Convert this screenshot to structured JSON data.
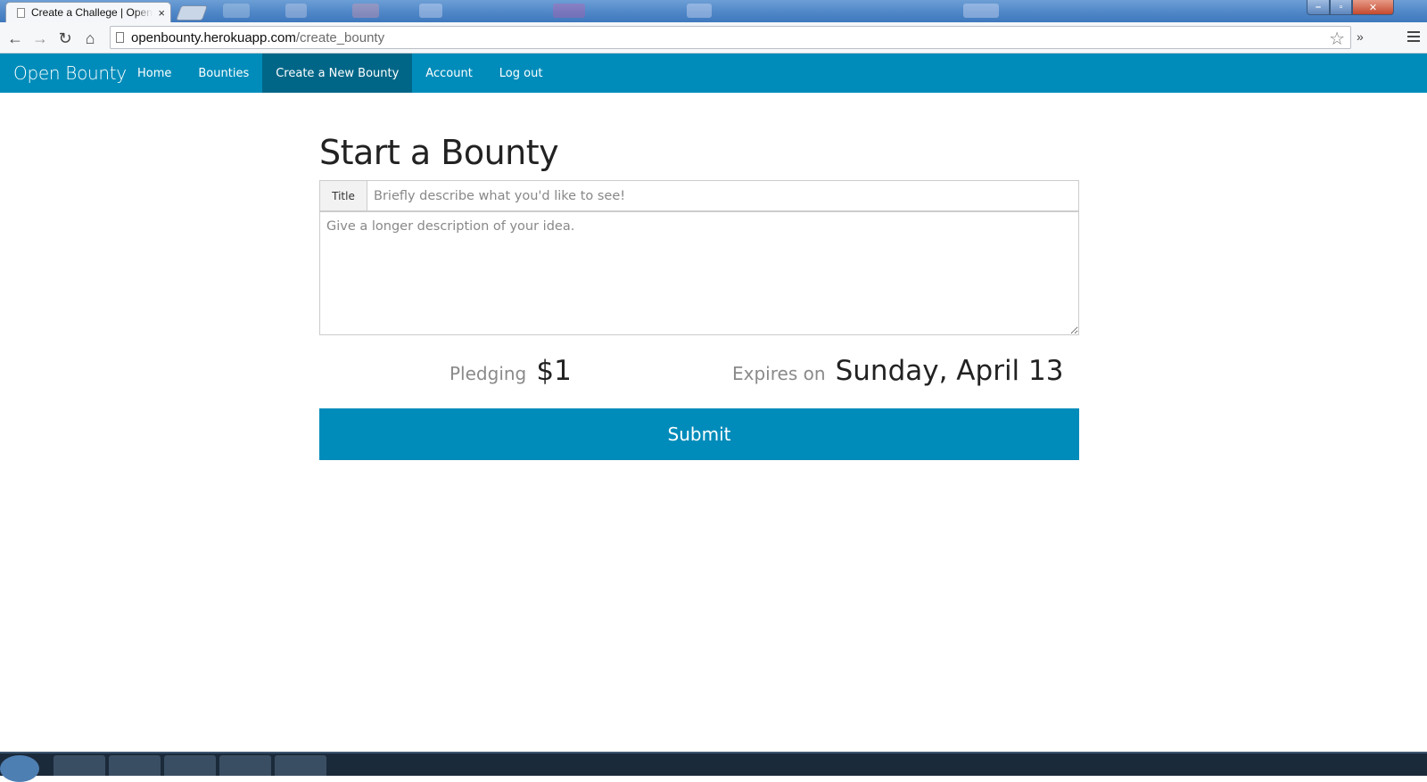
{
  "browser": {
    "tab_title": "Create a Challege | Open Bounty",
    "tab_close": "×",
    "url_host": "openbounty.herokuapp.com",
    "url_path": "/create_bounty",
    "back": "←",
    "forward": "→",
    "reload": "↻",
    "home": "⌂",
    "bookmark_star": "☆",
    "extensions": "»",
    "window_minimize": "–",
    "window_maximize": "▫",
    "window_close": "✕"
  },
  "navbar": {
    "brand": "Open Bounty",
    "links": [
      {
        "label": "Home"
      },
      {
        "label": "Bounties"
      },
      {
        "label": "Create a New Bounty",
        "active": true
      },
      {
        "label": "Account"
      },
      {
        "label": "Log out"
      }
    ],
    "color": "#008cba",
    "active_color": "#006687"
  },
  "form": {
    "heading": "Start a Bounty",
    "title_label": "Title",
    "title_placeholder": "Briefly describe what you'd like to see!",
    "title_value": "",
    "description_placeholder": "Give a longer description of your idea.",
    "description_value": "",
    "pledge_label": "Pledging",
    "pledge_value": "$1",
    "expires_label": "Expires on",
    "expires_value": "Sunday, April 13",
    "submit_label": "Submit"
  }
}
